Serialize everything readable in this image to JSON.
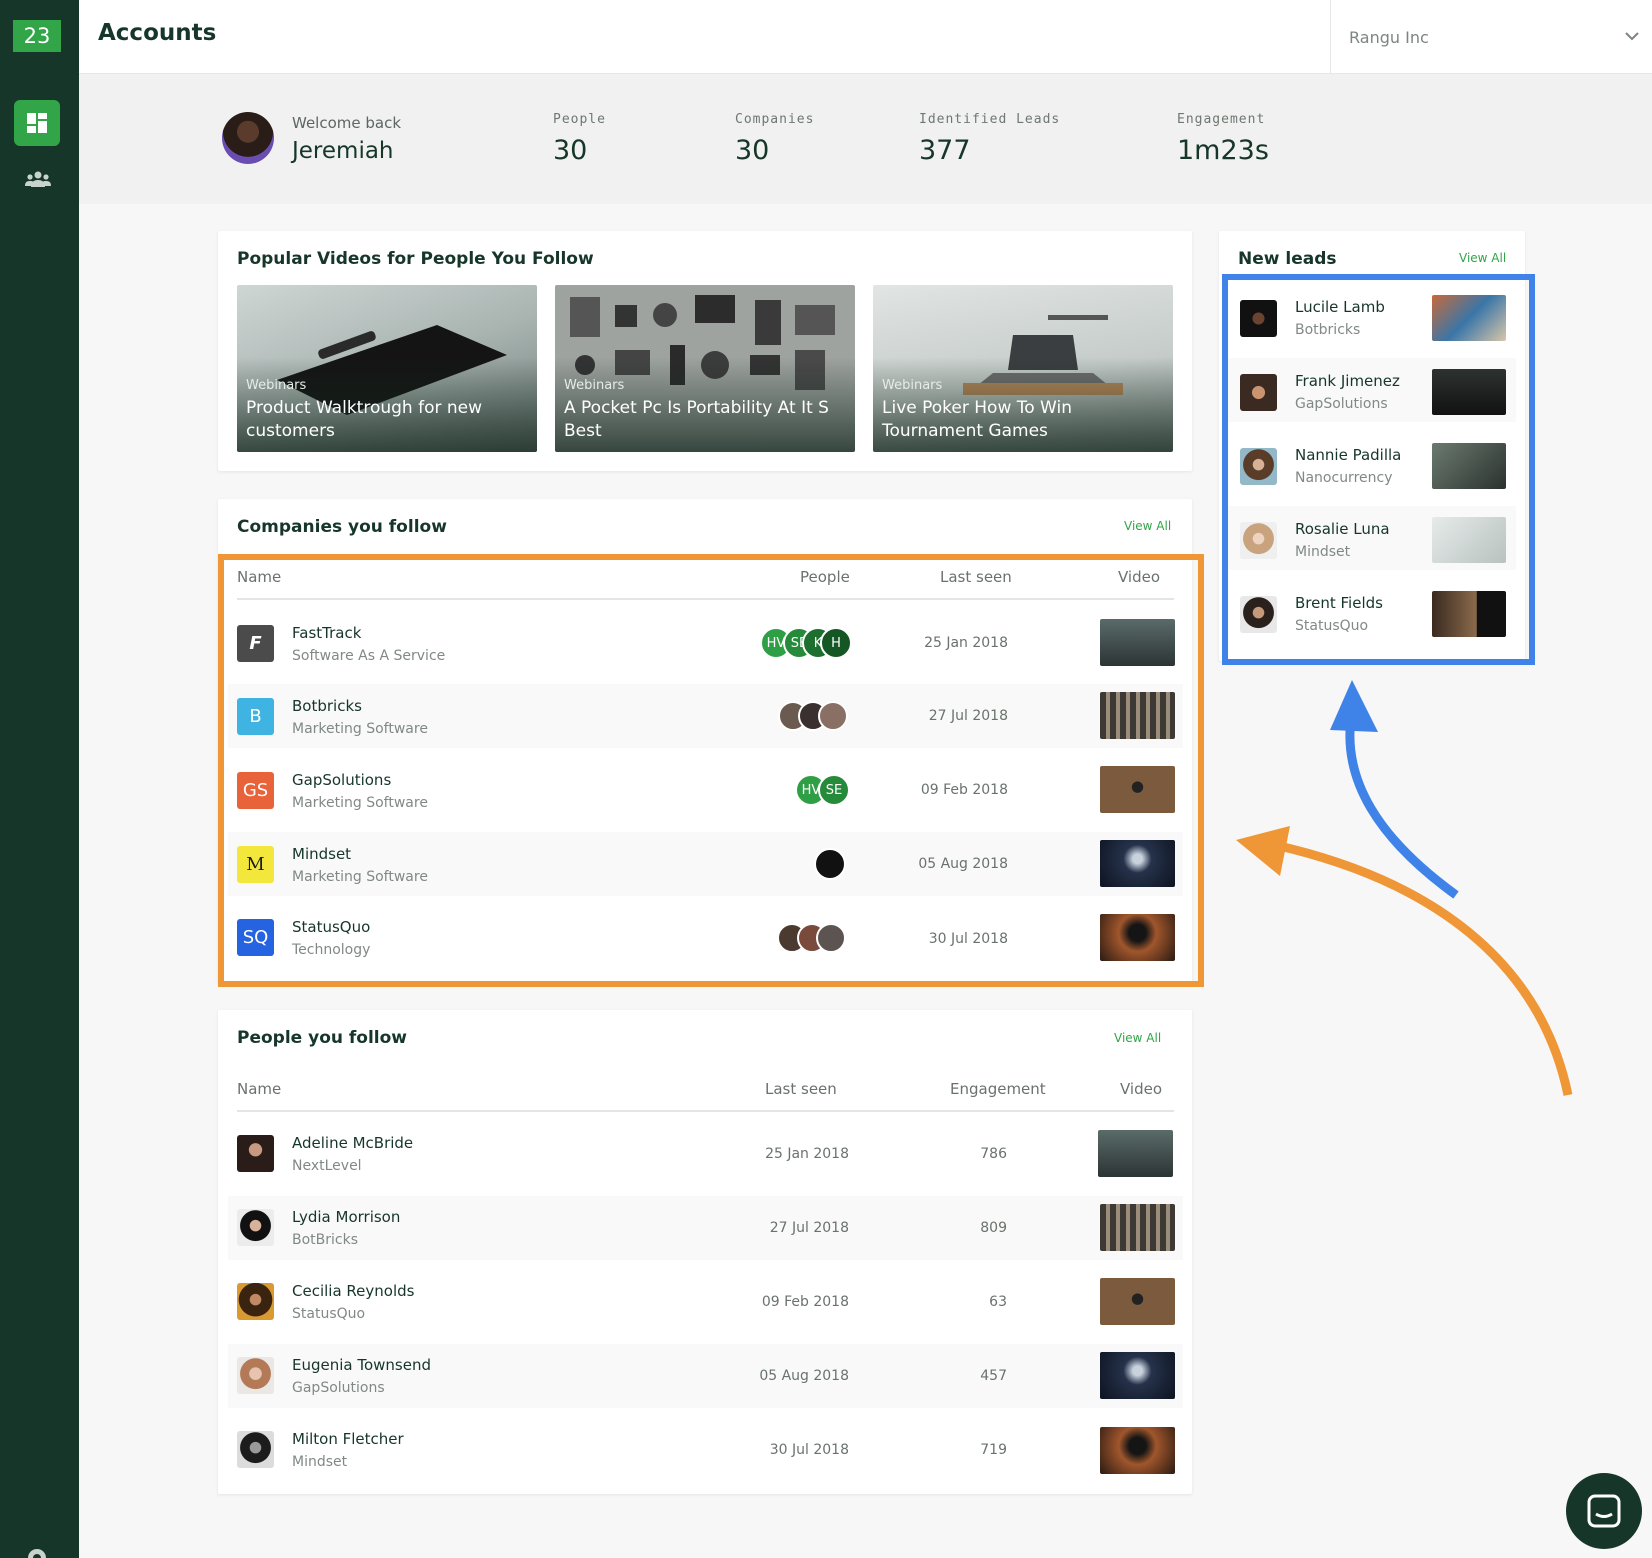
{
  "app": {
    "logo_text": "23",
    "page_title": "Accounts",
    "org_selector": "Rangu Inc"
  },
  "colors": {
    "sidebar": "#17362a",
    "accent": "#32a548",
    "orange_annotation": "#ef9636",
    "blue_annotation": "#3f82e8"
  },
  "welcome": {
    "greeting": "Welcome back",
    "name": "Jeremiah"
  },
  "stats": [
    {
      "label": "People",
      "value": "30"
    },
    {
      "label": "Companies",
      "value": "30"
    },
    {
      "label": "Identified Leads",
      "value": "377"
    },
    {
      "label": "Engagement",
      "value": "1m23s"
    }
  ],
  "videos": {
    "title": "Popular Videos for People You Follow",
    "items": [
      {
        "category": "Webinars",
        "title": "Product Walktrough for new customers"
      },
      {
        "category": "Webinars",
        "title": "A Pocket Pc Is Portability At It S Best"
      },
      {
        "category": "Webinars",
        "title": "Live Poker How To Win Tournament Games"
      }
    ]
  },
  "companies": {
    "title": "Companies you follow",
    "view_all": "View All",
    "columns": [
      "Name",
      "People",
      "Last seen",
      "Video"
    ],
    "rows": [
      {
        "logo": "F",
        "name": "FastTrack",
        "category": "Software As A Service",
        "people": [
          "HV",
          "SE",
          "K",
          "H"
        ],
        "last_seen": "25 Jan 2018"
      },
      {
        "logo": "B",
        "name": "Botbricks",
        "category": "Marketing Software",
        "people": [],
        "last_seen": "27 Jul 2018"
      },
      {
        "logo": "GS",
        "name": "GapSolutions",
        "category": "Marketing Software",
        "people": [
          "HV",
          "SE"
        ],
        "last_seen": "09 Feb 2018"
      },
      {
        "logo": "M",
        "name": "Mindset",
        "category": "Marketing Software",
        "people": [],
        "last_seen": "05 Aug 2018"
      },
      {
        "logo": "SQ",
        "name": "StatusQuo",
        "category": "Technology",
        "people": [],
        "last_seen": "30 Jul 2018"
      }
    ]
  },
  "people": {
    "title": "People you follow",
    "view_all": "View All",
    "columns": [
      "Name",
      "Last seen",
      "Engagement",
      "Video"
    ],
    "rows": [
      {
        "name": "Adeline McBride",
        "company": "NextLevel",
        "last_seen": "25 Jan 2018",
        "engagement": "786"
      },
      {
        "name": "Lydia Morrison",
        "company": "BotBricks",
        "last_seen": "27 Jul 2018",
        "engagement": "809"
      },
      {
        "name": "Cecilia Reynolds",
        "company": "StatusQuo",
        "last_seen": "09 Feb 2018",
        "engagement": "63"
      },
      {
        "name": "Eugenia Townsend",
        "company": "GapSolutions",
        "last_seen": "05 Aug 2018",
        "engagement": "457"
      },
      {
        "name": "Milton Fletcher",
        "company": "Mindset",
        "last_seen": "30 Jul 2018",
        "engagement": "719"
      }
    ]
  },
  "leads": {
    "title": "New leads",
    "view_all": "View All",
    "items": [
      {
        "name": "Lucile Lamb",
        "company": "Botbricks"
      },
      {
        "name": "Frank Jimenez",
        "company": "GapSolutions"
      },
      {
        "name": "Nannie Padilla",
        "company": "Nanocurrency"
      },
      {
        "name": "Rosalie Luna",
        "company": "Mindset"
      },
      {
        "name": "Brent Fields",
        "company": "StatusQuo"
      }
    ]
  },
  "icons": [
    "dashboard-icon",
    "people-icon",
    "gear-icon",
    "chevron-down-icon",
    "chat-icon"
  ]
}
